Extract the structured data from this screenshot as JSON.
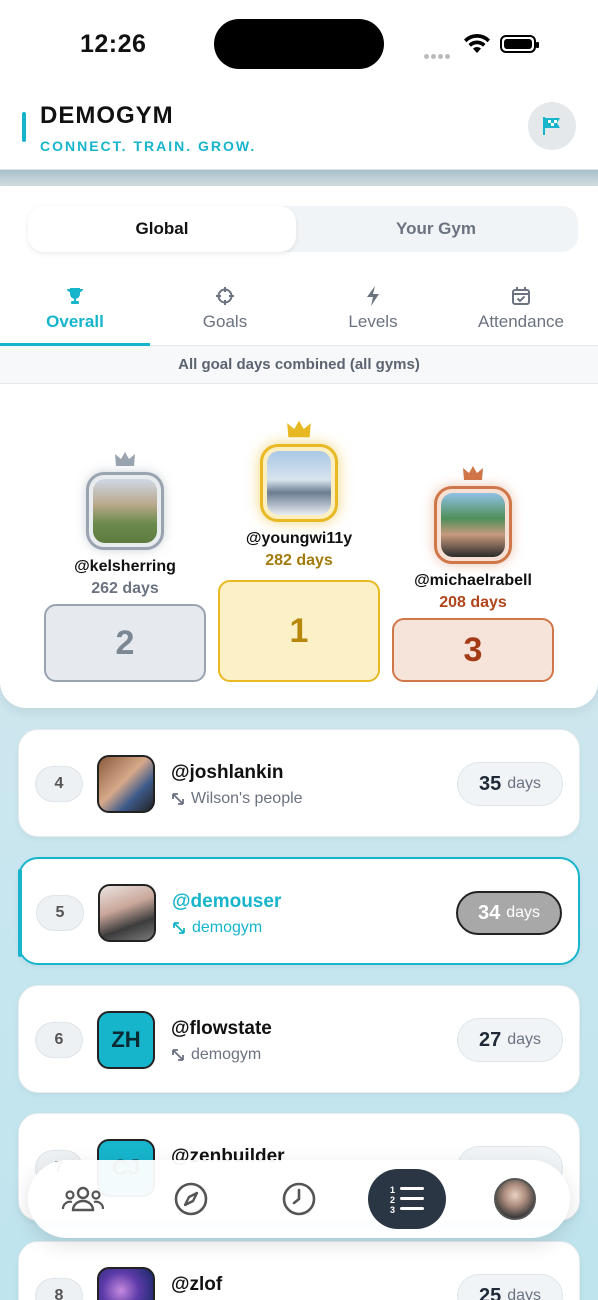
{
  "status_bar": {
    "time": "12:26"
  },
  "header": {
    "title": "DEMOGYM",
    "tagline": "CONNECT. TRAIN. GROW.",
    "flag_icon": "flag-icon"
  },
  "segment": {
    "global_label": "Global",
    "gym_label": "Your Gym",
    "selected": "Global"
  },
  "tabs": [
    {
      "label": "Overall",
      "icon": "trophy-icon",
      "active": true
    },
    {
      "label": "Goals",
      "icon": "crosshair-icon",
      "active": false
    },
    {
      "label": "Levels",
      "icon": "lightning-icon",
      "active": false
    },
    {
      "label": "Attendance",
      "icon": "calendar-check-icon",
      "active": false
    }
  ],
  "subtitle": "All goal days combined (all gyms)",
  "podium": {
    "first": {
      "rank": "1",
      "username": "@youngwi11y",
      "days": "282 days"
    },
    "second": {
      "rank": "2",
      "username": "@kelsherring",
      "days": "262 days"
    },
    "third": {
      "rank": "3",
      "username": "@michaelrabell",
      "days": "208 days"
    }
  },
  "leaderboard": [
    {
      "rank": "4",
      "username": "@joshlankin",
      "gym": "Wilson's people",
      "days": "35",
      "unit": "days"
    },
    {
      "rank": "5",
      "username": "@demouser",
      "gym": "demogym",
      "days": "34",
      "unit": "days",
      "current": true
    },
    {
      "rank": "6",
      "username": "@flowstate",
      "gym": "demogym",
      "days": "27",
      "unit": "days",
      "initials": "ZH"
    },
    {
      "rank": "7",
      "username": "@zenbuilder",
      "gym": "",
      "days": "",
      "unit": "",
      "initials": "CJ"
    },
    {
      "rank": "8",
      "username": "@zlof",
      "gym": "",
      "days": "25",
      "unit": "days"
    }
  ],
  "bottom_nav": [
    {
      "name": "community",
      "icon": "people-icon"
    },
    {
      "name": "explore",
      "icon": "compass-icon"
    },
    {
      "name": "history",
      "icon": "clock-icon"
    },
    {
      "name": "leaderboard",
      "icon": "ranked-list-icon",
      "active": true
    },
    {
      "name": "profile",
      "icon": "avatar"
    }
  ],
  "colors": {
    "accent": "#17b5cc",
    "gold": "#e8b923",
    "silver": "#9aa4b0",
    "bronze": "#d0774a",
    "nav_active": "#2a3644"
  }
}
